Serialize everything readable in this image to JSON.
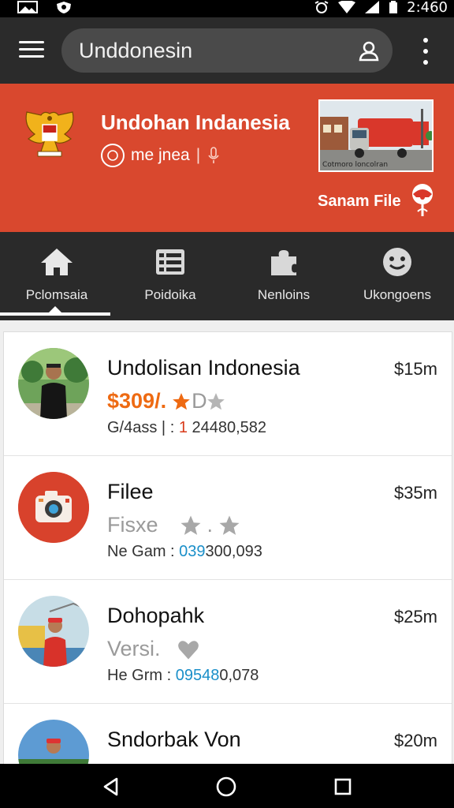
{
  "status_bar": {
    "time": "2:460"
  },
  "search": {
    "query": "Unddonesin"
  },
  "banner": {
    "title": "Undohan Indanesia",
    "subtitle": "me jnea",
    "image_caption": "Cotmoro loncolran",
    "action": "Sanam File"
  },
  "tabs": [
    {
      "label": "Pclomsaia",
      "icon": "home-icon",
      "active": true
    },
    {
      "label": "Poidoika",
      "icon": "list-icon",
      "active": false
    },
    {
      "label": "Nenloins",
      "icon": "puzzle-icon",
      "active": false
    },
    {
      "label": "Ukongoens",
      "icon": "smiley-icon",
      "active": false
    }
  ],
  "items": [
    {
      "name": "Undolisan Indonesia",
      "price": "$15m",
      "sub_value": "$309/.",
      "sub_suffix": "D",
      "meta_prefix": "G/4ass",
      "meta_sep": "|",
      "meta_colon": ":",
      "meta_highlight": "1",
      "meta_value": "24480,582"
    },
    {
      "name": "Filee",
      "price": "$35m",
      "sub_value": "Fisxe",
      "meta_prefix": "Ne",
      "meta_label": "Gam",
      "meta_colon": ":",
      "meta_highlight": "039",
      "meta_value": "300,093"
    },
    {
      "name": "Dohopahk",
      "price": "$25m",
      "sub_value": "Versi.",
      "meta_prefix": "He",
      "meta_label": "Grm",
      "meta_colon": ":",
      "meta_highlight": "09548",
      "meta_value": "0,078"
    },
    {
      "name": "Sndorbak Von",
      "price": "$20m"
    }
  ],
  "colors": {
    "banner": "#d9482e",
    "accent_orange": "#ee6a12",
    "accent_blue": "#1a8fc9"
  }
}
